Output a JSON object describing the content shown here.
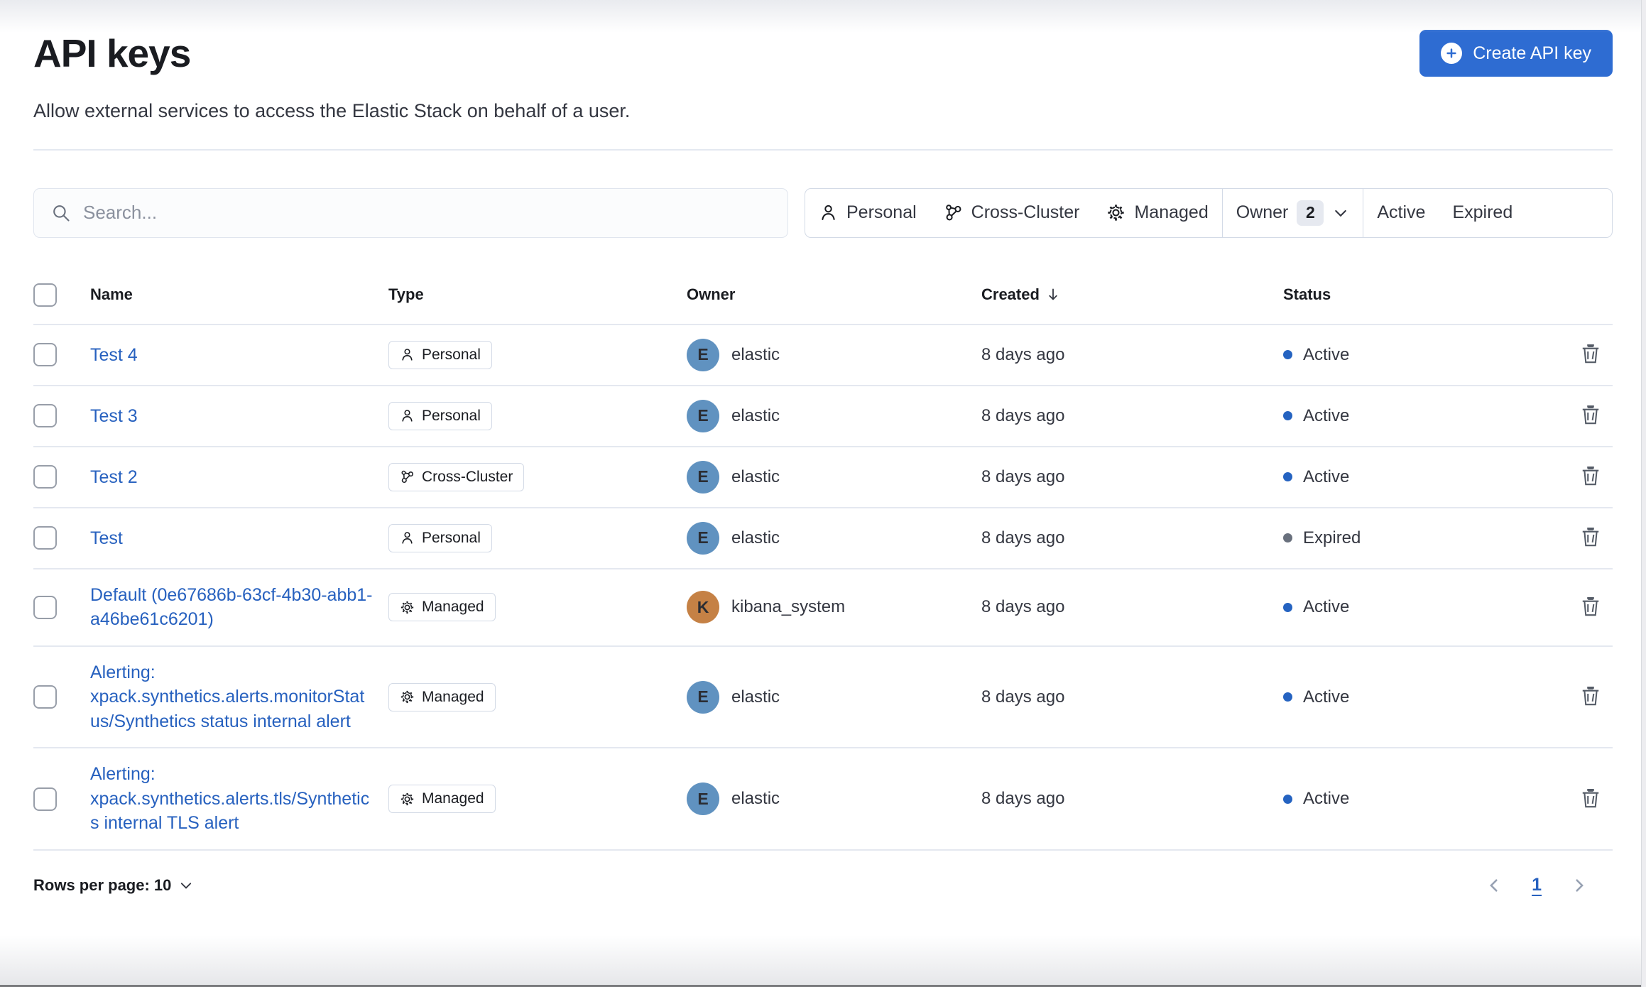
{
  "page": {
    "title": "API keys",
    "subtitle": "Allow external services to access the Elastic Stack on behalf of a user.",
    "create_button_label": "Create API key",
    "create_button_icon": "plus-in-circle-icon"
  },
  "search": {
    "placeholder": "Search..."
  },
  "filters": {
    "personal": {
      "label": "Personal",
      "icon": "user-icon"
    },
    "cross_cluster": {
      "label": "Cross-Cluster",
      "icon": "cluster-icon"
    },
    "managed": {
      "label": "Managed",
      "icon": "gear-icon"
    },
    "owner": {
      "label": "Owner",
      "count": "2",
      "icon": "chevron-down-icon"
    },
    "active": {
      "label": "Active"
    },
    "expired": {
      "label": "Expired"
    }
  },
  "table": {
    "columns": {
      "name": "Name",
      "type": "Type",
      "owner": "Owner",
      "created": "Created",
      "status": "Status"
    },
    "sort": {
      "column": "Created",
      "direction": "desc"
    },
    "rows": [
      {
        "name": "Test 4",
        "type": "Personal",
        "type_icon": "icon-user",
        "owner": "elastic",
        "owner_initial": "E",
        "avatar_color": "#6092C0",
        "created": "8 days ago",
        "status": "Active",
        "status_color": "#2563c1"
      },
      {
        "name": "Test 3",
        "type": "Personal",
        "type_icon": "icon-user",
        "owner": "elastic",
        "owner_initial": "E",
        "avatar_color": "#6092C0",
        "created": "8 days ago",
        "status": "Active",
        "status_color": "#2563c1"
      },
      {
        "name": "Test 2",
        "type": "Cross-Cluster",
        "type_icon": "icon-cluster",
        "owner": "elastic",
        "owner_initial": "E",
        "avatar_color": "#6092C0",
        "created": "8 days ago",
        "status": "Active",
        "status_color": "#2563c1"
      },
      {
        "name": "Test",
        "type": "Personal",
        "type_icon": "icon-user",
        "owner": "elastic",
        "owner_initial": "E",
        "avatar_color": "#6092C0",
        "created": "8 days ago",
        "status": "Expired",
        "status_color": "#69707d"
      },
      {
        "name": "Default (0e67686b-63cf-4b30-abb1-a46be61c6201)",
        "type": "Managed",
        "type_icon": "icon-gear",
        "owner": "kibana_system",
        "owner_initial": "K",
        "avatar_color": "#c58145",
        "created": "8 days ago",
        "status": "Active",
        "status_color": "#2563c1"
      },
      {
        "name": "Alerting: xpack.synthetics.alerts.monitorStatus/Synthetics status internal alert",
        "type": "Managed",
        "type_icon": "icon-gear",
        "owner": "elastic",
        "owner_initial": "E",
        "avatar_color": "#6092C0",
        "created": "8 days ago",
        "status": "Active",
        "status_color": "#2563c1"
      },
      {
        "name": "Alerting: xpack.synthetics.alerts.tls/Synthetics internal TLS alert",
        "type": "Managed",
        "type_icon": "icon-gear",
        "owner": "elastic",
        "owner_initial": "E",
        "avatar_color": "#6092C0",
        "created": "8 days ago",
        "status": "Active",
        "status_color": "#2563c1"
      }
    ]
  },
  "pagination": {
    "rows_per_page_label": "Rows per page: 10",
    "current_page": "1"
  },
  "colors": {
    "primary_button": "#2e6cd2",
    "link": "#2761bf",
    "active_dot": "#2563c1",
    "expired_dot": "#69707d"
  }
}
